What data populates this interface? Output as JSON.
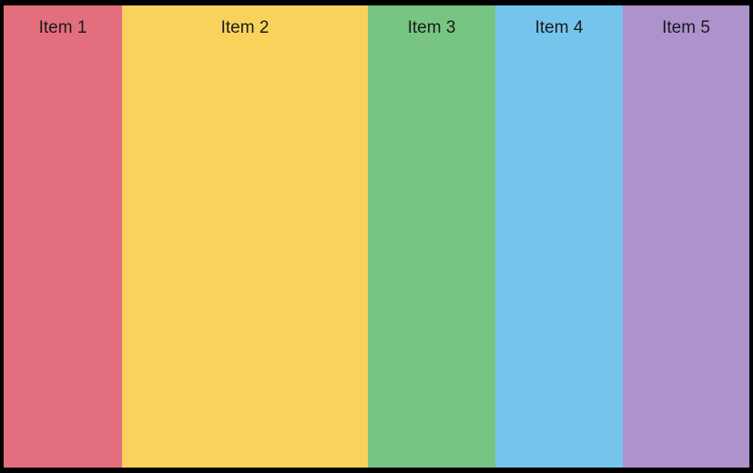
{
  "columns": [
    {
      "label": "Item 1",
      "color": "#e36e7e"
    },
    {
      "label": "Item 2",
      "color": "#f9d25c"
    },
    {
      "label": "Item 3",
      "color": "#78c482"
    },
    {
      "label": "Item 4",
      "color": "#74c4eb"
    },
    {
      "label": "Item 5",
      "color": "#ad92cc"
    }
  ]
}
